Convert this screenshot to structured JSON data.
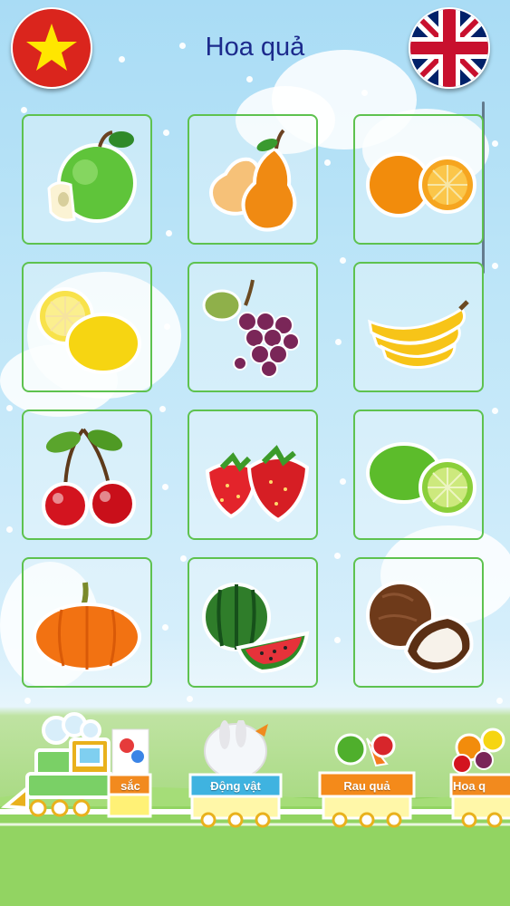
{
  "header": {
    "title": "Hoa quả",
    "lang_vi_icon": "vietnam-flag-icon",
    "lang_en_icon": "uk-flag-icon"
  },
  "grid": {
    "items": [
      {
        "icon": "apple-icon"
      },
      {
        "icon": "pear-icon"
      },
      {
        "icon": "orange-icon"
      },
      {
        "icon": "lemon-icon"
      },
      {
        "icon": "grapes-icon"
      },
      {
        "icon": "banana-icon"
      },
      {
        "icon": "cherry-icon"
      },
      {
        "icon": "strawberry-icon"
      },
      {
        "icon": "lime-icon"
      },
      {
        "icon": "pumpkin-icon"
      },
      {
        "icon": "watermelon-icon"
      },
      {
        "icon": "coconut-icon"
      }
    ]
  },
  "train": {
    "cars": [
      {
        "label": "sắc"
      },
      {
        "label": "Động vật"
      },
      {
        "label": "Rau quả"
      },
      {
        "label": "Hoa q"
      }
    ]
  },
  "colors": {
    "title": "#1c2a8c",
    "card_border": "#5ec24f",
    "sky": "#bfe6f8",
    "grass": "#8fd05f"
  }
}
